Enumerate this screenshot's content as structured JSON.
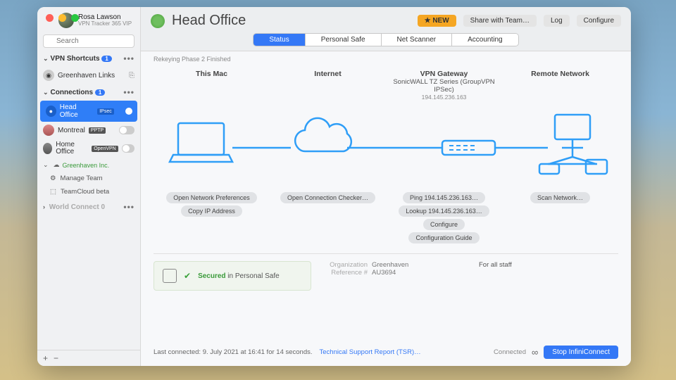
{
  "user": {
    "name": "Rosa Lawson",
    "subtitle": "VPN Tracker 365 VIP"
  },
  "search": {
    "placeholder": "Search"
  },
  "sidebar": {
    "shortcuts": {
      "label": "VPN Shortcuts",
      "count": "1",
      "items": [
        "Greenhaven Links"
      ]
    },
    "connections": {
      "label": "Connections",
      "count": "1",
      "items": [
        {
          "name": "Head Office",
          "proto": "IPsec",
          "active": true
        },
        {
          "name": "Montreal",
          "proto": "PPTP",
          "active": false
        },
        {
          "name": "Home Office",
          "proto": "OpenVPN",
          "active": false
        }
      ],
      "org": "Greenhaven Inc.",
      "manage": "Manage Team",
      "teamcloud": "TeamCloud beta"
    },
    "worldconnect": {
      "label": "World Connect",
      "count": "0"
    }
  },
  "header": {
    "title": "Head Office",
    "new": "NEW",
    "share": "Share with Team…",
    "log": "Log",
    "configure": "Configure"
  },
  "tabs": [
    "Status",
    "Personal Safe",
    "Net Scanner",
    "Accounting"
  ],
  "status_line": "Rekeying Phase 2 Finished",
  "topology": {
    "thismac": "This Mac",
    "internet": "Internet",
    "gateway": {
      "title": "VPN Gateway",
      "sub": "SonicWALL TZ Series (GroupVPN IPSec)",
      "ip": "194.145.236.163"
    },
    "remote": "Remote Network"
  },
  "actions": {
    "mac": [
      "Open Network Preferences",
      "Copy IP Address"
    ],
    "internet": [
      "Open Connection Checker…"
    ],
    "gateway": [
      "Ping 194.145.236.163…",
      "Lookup 194.145.236.163…",
      "Configure",
      "Configuration Guide"
    ],
    "remote": [
      "Scan Network…"
    ]
  },
  "safe": {
    "secured": "Secured",
    "in": " in Personal Safe"
  },
  "meta": {
    "org_k": "Organization",
    "org_v": "Greenhaven",
    "ref_k": "Reference #",
    "ref_v": "AU3694"
  },
  "note": "For all staff",
  "footer": {
    "last": "Last connected: 9. July 2021 at 16:41 for 14 seconds.",
    "tsr": "Technical Support Report (TSR)…",
    "connected": "Connected",
    "stop": "Stop InfiniConnect"
  }
}
